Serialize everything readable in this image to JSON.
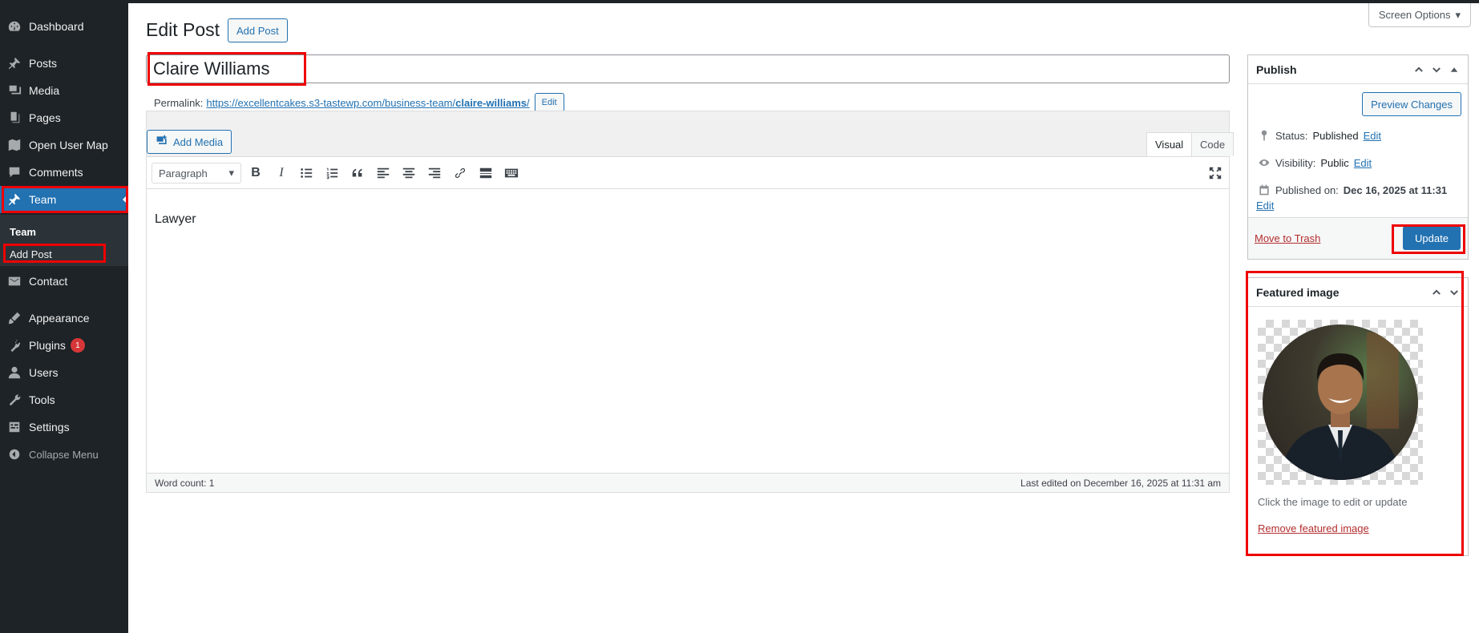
{
  "sidebar": {
    "items": [
      {
        "label": "Dashboard",
        "icon": "dashboard-icon"
      },
      {
        "label": "Posts",
        "icon": "pin-icon"
      },
      {
        "label": "Media",
        "icon": "media-icon"
      },
      {
        "label": "Pages",
        "icon": "pages-icon"
      },
      {
        "label": "Open User Map",
        "icon": "map-icon"
      },
      {
        "label": "Comments",
        "icon": "comments-icon"
      },
      {
        "label": "Team",
        "icon": "pin-icon"
      },
      {
        "label": "Contact",
        "icon": "mail-icon"
      },
      {
        "label": "Appearance",
        "icon": "brush-icon"
      },
      {
        "label": "Plugins",
        "icon": "plugin-icon",
        "badge": "1"
      },
      {
        "label": "Users",
        "icon": "user-icon"
      },
      {
        "label": "Tools",
        "icon": "wrench-icon"
      },
      {
        "label": "Settings",
        "icon": "settings-icon"
      },
      {
        "label": "Collapse Menu",
        "icon": "collapse-icon"
      }
    ],
    "submenu": [
      "Team",
      "Add Post"
    ]
  },
  "header": {
    "screen_options": "Screen Options",
    "title": "Edit Post",
    "add_post": "Add Post"
  },
  "post": {
    "title": "Claire Williams",
    "permalink_label": "Permalink:",
    "permalink_base": "https://excellentcakes.s3-tastewp.com/business-team/",
    "permalink_slug": "claire-williams",
    "permalink_end": "/",
    "permalink_edit": "Edit",
    "content": "Lawyer"
  },
  "editor": {
    "add_media": "Add Media",
    "tab_visual": "Visual",
    "tab_code": "Code",
    "format": "Paragraph",
    "word_count": "Word count: 1",
    "last_edited": "Last edited on December 16, 2025 at 11:31 am"
  },
  "publish": {
    "title": "Publish",
    "preview": "Preview Changes",
    "status_label": "Status:",
    "status_value": "Published",
    "visibility_label": "Visibility:",
    "visibility_value": "Public",
    "published_label": "Published on:",
    "published_value": "Dec 16, 2025 at 11:31",
    "edit": "Edit",
    "trash": "Move to Trash",
    "update": "Update"
  },
  "featured": {
    "title": "Featured image",
    "hint": "Click the image to edit or update",
    "remove": "Remove featured image"
  },
  "colors": {
    "sidebar": "#1d2327",
    "accent": "#2271b1",
    "highlight": "#e00000",
    "danger": "#b32d2e"
  }
}
